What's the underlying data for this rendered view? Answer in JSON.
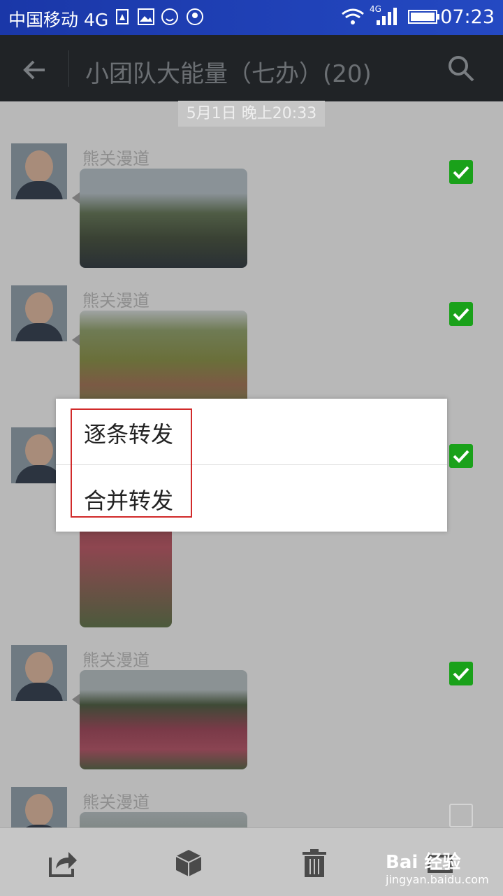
{
  "status_bar": {
    "carrier": "中国移动 4G",
    "network_badge": "4G",
    "time": "07:23"
  },
  "app_bar": {
    "title": "小团队大能量（七办）(20)"
  },
  "chat": {
    "date_divider": "5月1日 晚上20:33",
    "messages": [
      {
        "sender": "熊关漫道",
        "checked": true
      },
      {
        "sender": "熊关漫道",
        "checked": true
      },
      {
        "sender": "",
        "checked": true
      },
      {
        "sender": "熊关漫道",
        "checked": true
      },
      {
        "sender": "熊关漫道",
        "checked": false
      }
    ]
  },
  "dialog": {
    "items": [
      "逐条转发",
      "合并转发"
    ]
  },
  "bottom_bar": {
    "icons": [
      "share-icon",
      "box-icon",
      "trash-icon",
      "more-icon"
    ]
  },
  "watermark": {
    "brand": "Bai 经验",
    "url": "jingyan.baidu.com"
  },
  "colors": {
    "status_bar": "#1a37a8",
    "app_bar": "#202326",
    "check_green": "#1aa11a",
    "highlight": "#d12a2a"
  }
}
